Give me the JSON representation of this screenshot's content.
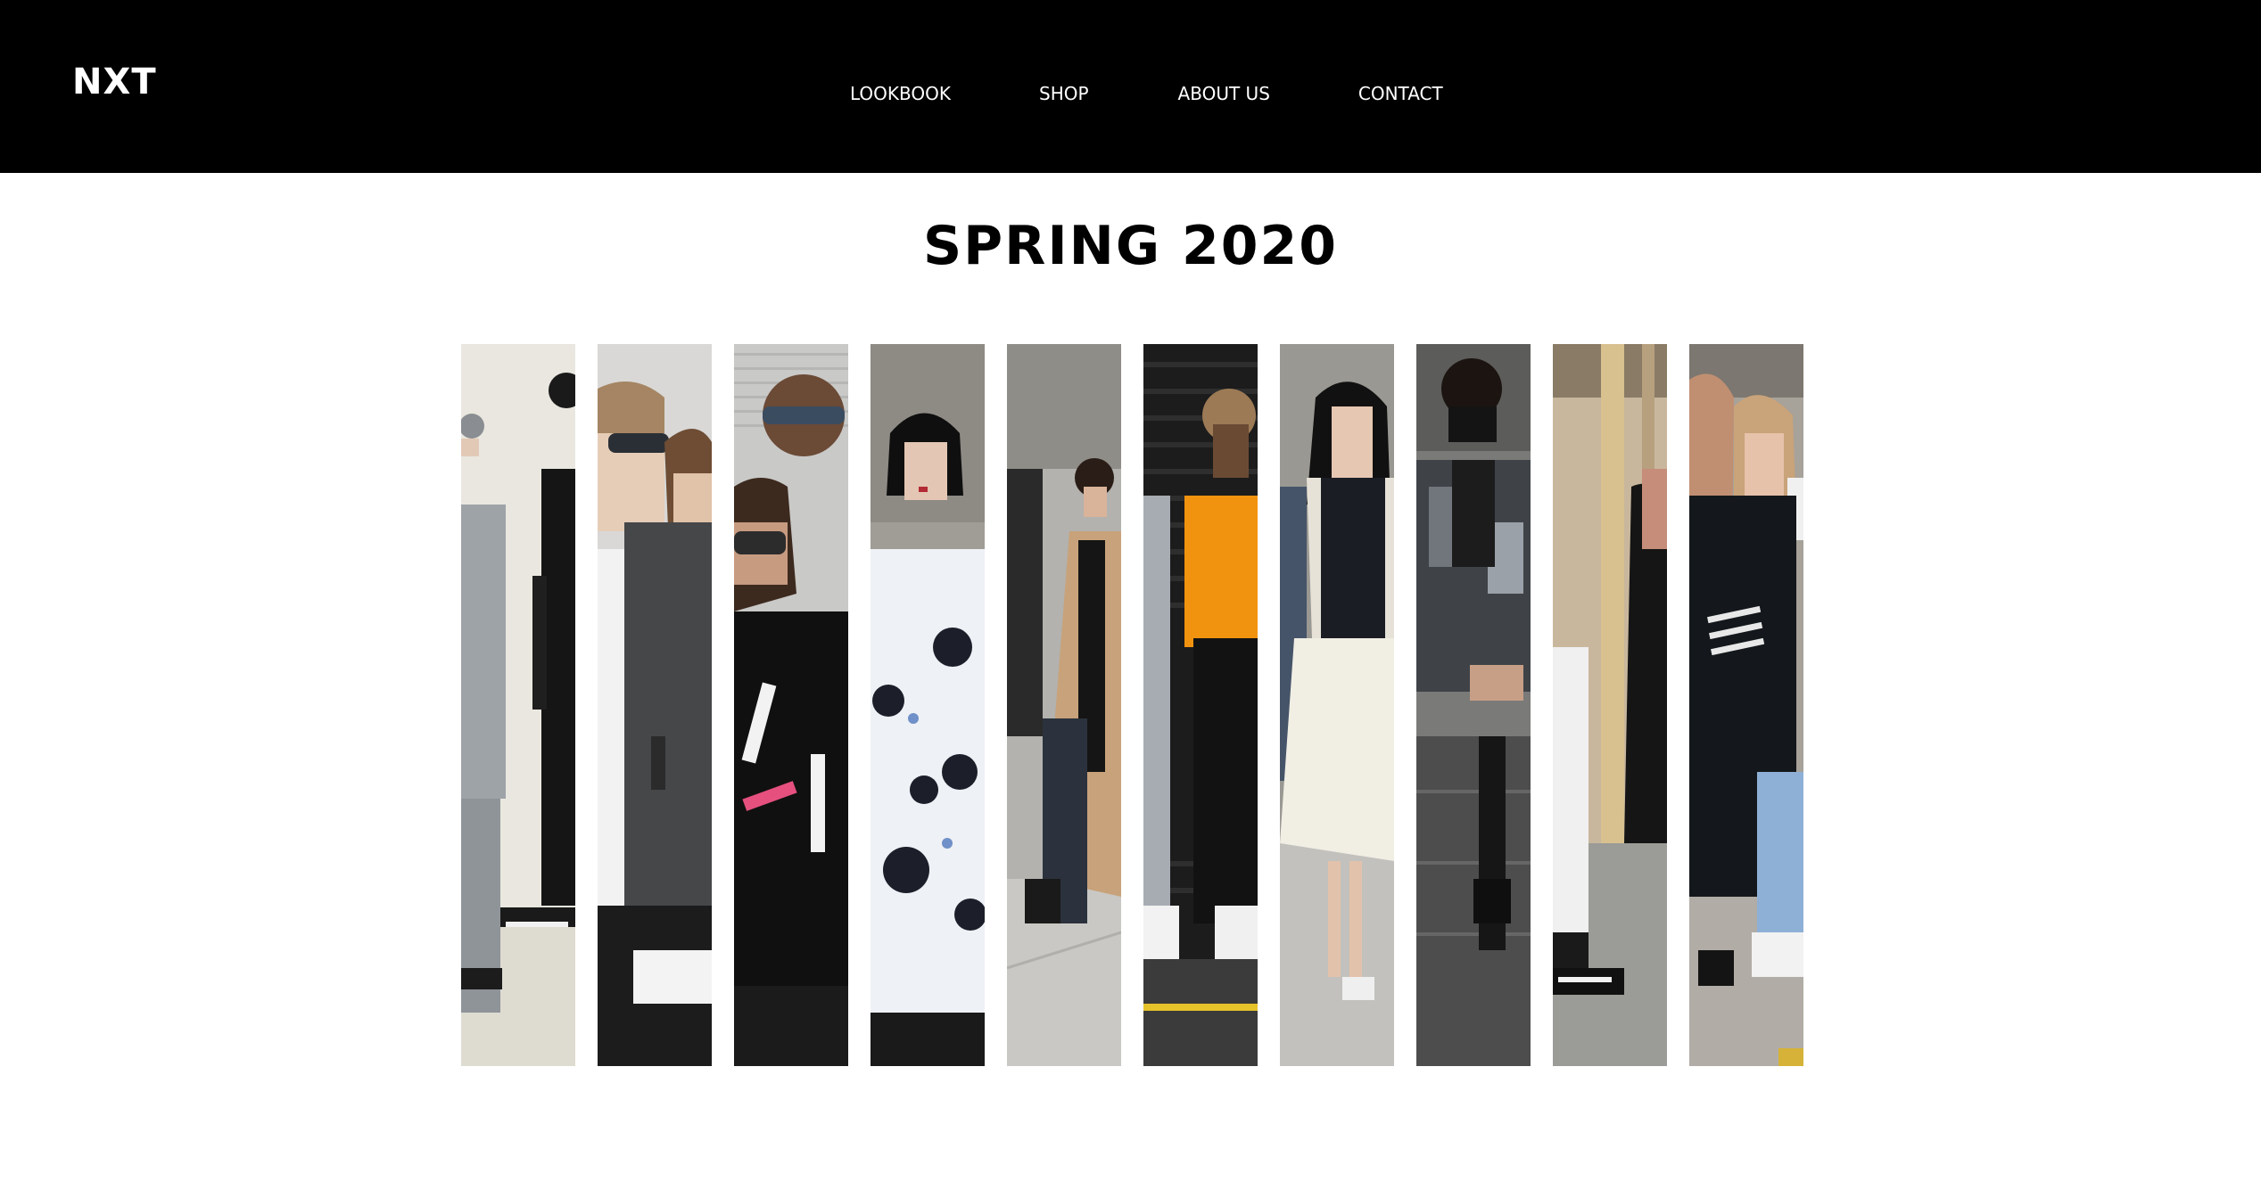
{
  "header": {
    "logo": "NXT",
    "nav": [
      {
        "label": "LOOKBOOK"
      },
      {
        "label": "SHOP"
      },
      {
        "label": "ABOUT US"
      },
      {
        "label": "CONTACT"
      }
    ]
  },
  "main": {
    "title": "SPRING 2020",
    "gallery": [
      {
        "name": "lookbook-photo-1"
      },
      {
        "name": "lookbook-photo-2"
      },
      {
        "name": "lookbook-photo-3"
      },
      {
        "name": "lookbook-photo-4"
      },
      {
        "name": "lookbook-photo-5"
      },
      {
        "name": "lookbook-photo-6"
      },
      {
        "name": "lookbook-photo-7"
      },
      {
        "name": "lookbook-photo-8"
      },
      {
        "name": "lookbook-photo-9"
      },
      {
        "name": "lookbook-photo-10"
      }
    ]
  },
  "colors": {
    "header_bg": "#000000",
    "header_text": "#ffffff",
    "page_bg": "#ffffff",
    "title_text": "#000000"
  }
}
